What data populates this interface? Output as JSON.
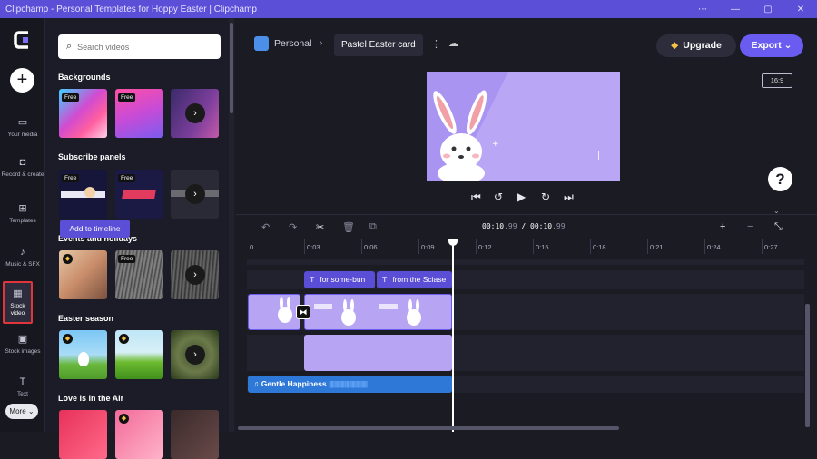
{
  "window": {
    "title": "Clipchamp - Personal Templates for Hoppy Easter | Clipchamp",
    "controls": [
      "⋯",
      "—",
      "▢",
      "✕"
    ]
  },
  "rail": {
    "items": [
      {
        "label": "Your media",
        "icon": "folder-icon",
        "glyph": "▭"
      },
      {
        "label": "Record & create",
        "icon": "camera-icon",
        "glyph": "◘"
      },
      {
        "label": "Templates",
        "icon": "templates-icon",
        "glyph": "⊞"
      },
      {
        "label": "Music & SFX",
        "icon": "music-icon",
        "glyph": "♪"
      },
      {
        "label": "Stock video",
        "icon": "film-icon",
        "glyph": "▦"
      },
      {
        "label": "Stock images",
        "icon": "image-icon",
        "glyph": "▣"
      },
      {
        "label": "Text",
        "icon": "text-icon",
        "glyph": "T"
      }
    ],
    "more_label": "More ⌄"
  },
  "library": {
    "search_placeholder": "Search videos",
    "sections": [
      "Backgrounds",
      "Subscribe panels",
      "Events and holidays",
      "Easter season",
      "Love is in the Air"
    ],
    "badge_free": "Free",
    "tooltip": "Add to timeline"
  },
  "topbar": {
    "workspace": "Personal",
    "project_name": "Pastel Easter card",
    "upgrade_label": "Upgrade",
    "export_label": "Export"
  },
  "preview": {
    "aspect_ratio": "16:9"
  },
  "timeline": {
    "current_time": "00:10",
    "current_frames": ".99",
    "separator": " / ",
    "total_time": "00:10",
    "total_frames": ".99",
    "ruler_ticks": [
      "0",
      "0:03",
      "0:06",
      "0:09",
      "0:12",
      "0:15",
      "0:18",
      "0:21",
      "0:24",
      "0:27"
    ],
    "text_clips": [
      "for some-bun",
      "from the Sciase"
    ],
    "audio_clip": "Gentle Happiness"
  },
  "colors": {
    "accent": "#6a5cf0",
    "titlebar": "#5b4fd8",
    "clip_lavender": "#b7a5f4",
    "audio": "#2e78d8"
  }
}
